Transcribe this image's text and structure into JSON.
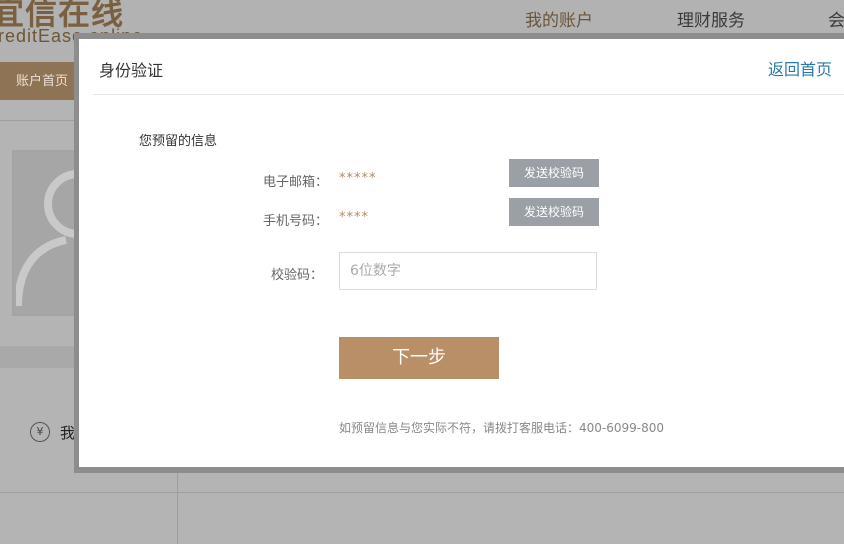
{
  "background": {
    "logo_cn": "宜信在线",
    "logo_en": "reditEase online",
    "nav": [
      "我的账户",
      "理财服务",
      "会"
    ],
    "subnav_tab": "账户首页",
    "yen_symbol": "¥",
    "my_text": "我"
  },
  "modal": {
    "title": "身份验证",
    "back_link": "返回首页",
    "section_label": "您预留的信息",
    "email": {
      "label": "电子邮箱：",
      "value": "*****",
      "button": "发送校验码"
    },
    "phone": {
      "label": "手机号码：",
      "value": "****",
      "button": "发送校验码"
    },
    "code": {
      "label": "校验码：",
      "placeholder": "6位数字",
      "value": ""
    },
    "next_button": "下一步",
    "footnote": "如预留信息与您实际不符，请拨打客服电话：400-6099-800"
  },
  "colors": {
    "accent": "#b88f66",
    "link": "#2a7aa8",
    "send_button": "#9aa0a6",
    "masked_value": "#b08a66"
  }
}
